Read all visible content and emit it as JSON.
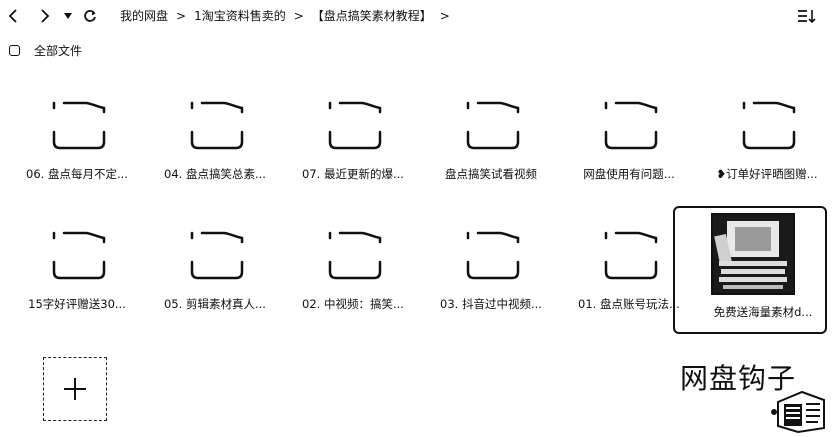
{
  "toolbar": {
    "breadcrumb": [
      "我的网盘",
      "1淘宝资料售卖的",
      "【盘点搞笑素材教程】"
    ],
    "separator": ">"
  },
  "select_all_label": "全部文件",
  "files": [
    {
      "name": "06. 盘点每月不定..."
    },
    {
      "name": "04. 盘点搞笑总素..."
    },
    {
      "name": "07. 最近更新的爆..."
    },
    {
      "name": "盘点搞笑试看视频"
    },
    {
      "name": "网盘使用有问题..."
    },
    {
      "name": "❥订单好评晒图赠..."
    },
    {
      "name": "15字好评赠送30..."
    },
    {
      "name": "05. 剪辑素材真人..."
    },
    {
      "name": "02. 中视频：搞笑..."
    },
    {
      "name": "03. 抖音过中视频..."
    },
    {
      "name": "01. 盘点账号玩法..."
    },
    {
      "name": "免费送海量素材d..."
    }
  ],
  "watermark": "网盘钩子"
}
